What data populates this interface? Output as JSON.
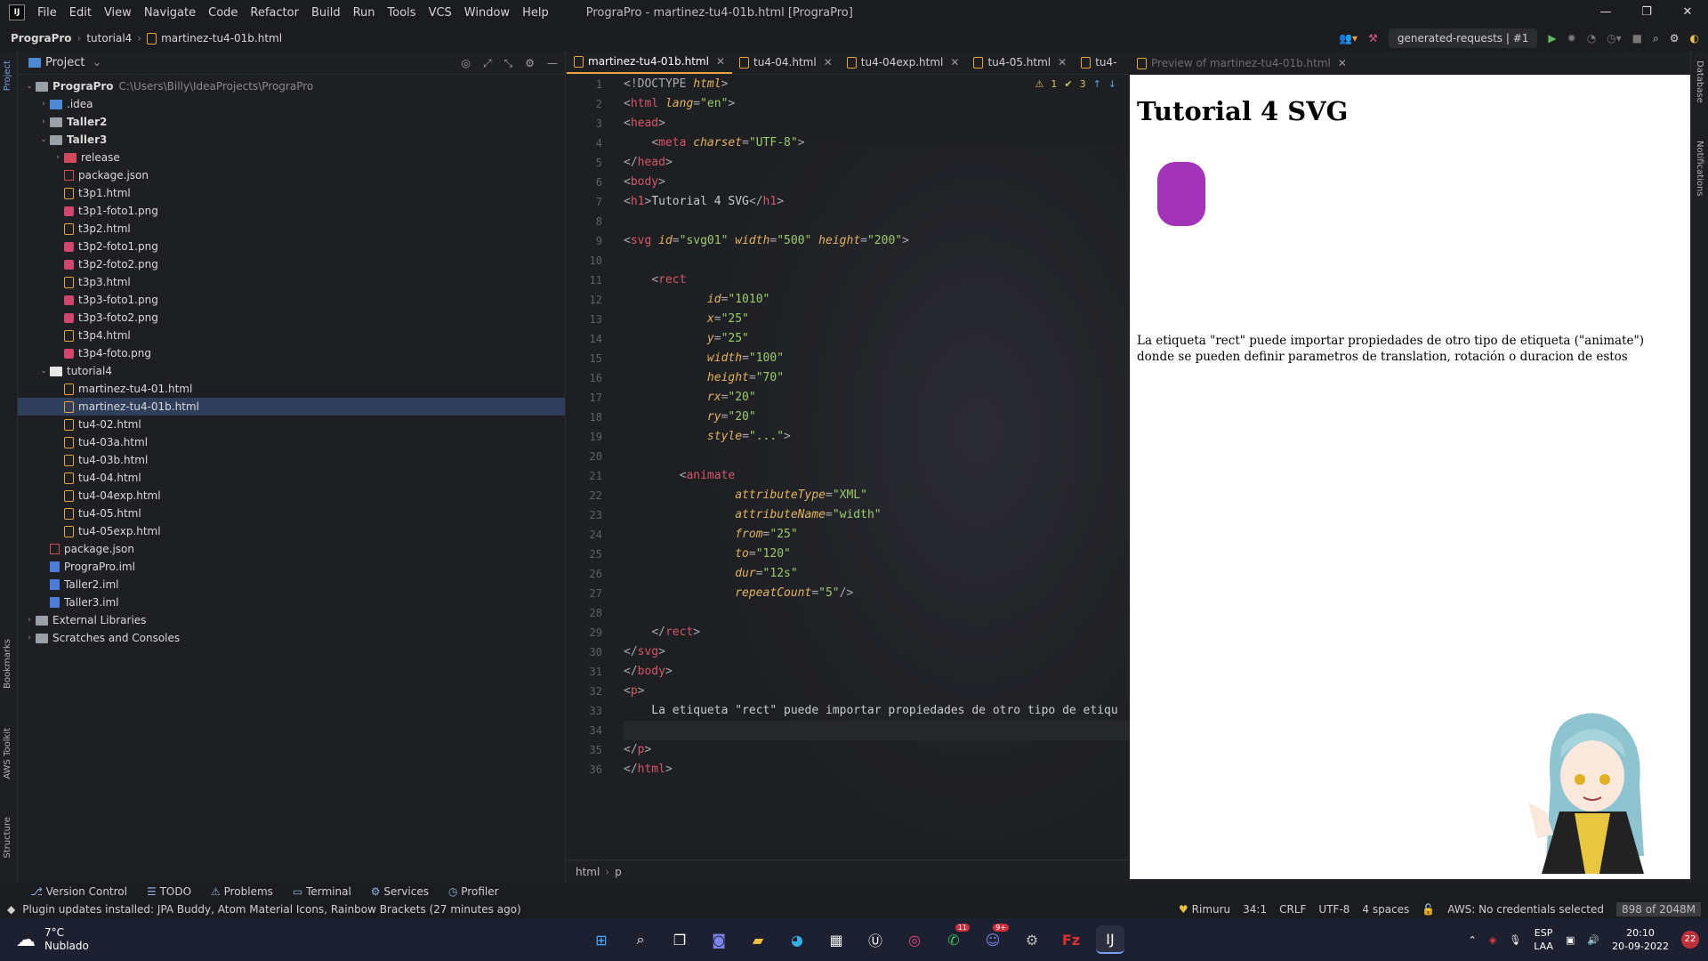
{
  "titlebar": {
    "menu": [
      "File",
      "Edit",
      "View",
      "Navigate",
      "Code",
      "Refactor",
      "Build",
      "Run",
      "Tools",
      "VCS",
      "Window",
      "Help"
    ],
    "title": "PrograPro - martinez-tu4-01b.html [PrograPro]",
    "controls": [
      "—",
      "❐",
      "✕"
    ]
  },
  "navbar": {
    "crumbs": [
      "PrograPro",
      "tutorial4",
      "martinez-tu4-01b.html"
    ],
    "run_config": "generated-requests | #1"
  },
  "project": {
    "title": "Project",
    "root": {
      "name": "PrograPro",
      "path": "C:\\Users\\Billy\\IdeaProjects\\PrograPro"
    },
    "items": [
      {
        "label": ".idea",
        "icon": "folder-blue",
        "depth": 1,
        "arrow": "›"
      },
      {
        "label": "Taller2",
        "icon": "folder",
        "depth": 1,
        "arrow": "›",
        "bold": true
      },
      {
        "label": "Taller3",
        "icon": "folder",
        "depth": 1,
        "arrow": "⌄",
        "bold": true
      },
      {
        "label": "release",
        "icon": "folder-red",
        "depth": 2,
        "arrow": "›"
      },
      {
        "label": "package.json",
        "icon": "json",
        "depth": 2
      },
      {
        "label": "t3p1.html",
        "icon": "html",
        "depth": 2
      },
      {
        "label": "t3p1-foto1.png",
        "icon": "png",
        "depth": 2
      },
      {
        "label": "t3p2.html",
        "icon": "html",
        "depth": 2
      },
      {
        "label": "t3p2-foto1.png",
        "icon": "png",
        "depth": 2
      },
      {
        "label": "t3p2-foto2.png",
        "icon": "png",
        "depth": 2
      },
      {
        "label": "t3p3.html",
        "icon": "html",
        "depth": 2
      },
      {
        "label": "t3p3-foto1.png",
        "icon": "png",
        "depth": 2
      },
      {
        "label": "t3p3-foto2.png",
        "icon": "png",
        "depth": 2
      },
      {
        "label": "t3p4.html",
        "icon": "html",
        "depth": 2
      },
      {
        "label": "t3p4-foto.png",
        "icon": "png",
        "depth": 2
      },
      {
        "label": "tutorial4",
        "icon": "folder-white",
        "depth": 1,
        "arrow": "⌄"
      },
      {
        "label": "martinez-tu4-01.html",
        "icon": "html",
        "depth": 2
      },
      {
        "label": "martinez-tu4-01b.html",
        "icon": "html",
        "depth": 2,
        "selected": true
      },
      {
        "label": "tu4-02.html",
        "icon": "html",
        "depth": 2
      },
      {
        "label": "tu4-03a.html",
        "icon": "html",
        "depth": 2
      },
      {
        "label": "tu4-03b.html",
        "icon": "html",
        "depth": 2
      },
      {
        "label": "tu4-04.html",
        "icon": "html",
        "depth": 2
      },
      {
        "label": "tu4-04exp.html",
        "icon": "html",
        "depth": 2
      },
      {
        "label": "tu4-05.html",
        "icon": "html",
        "depth": 2
      },
      {
        "label": "tu4-05exp.html",
        "icon": "html",
        "depth": 2
      },
      {
        "label": "package.json",
        "icon": "json",
        "depth": 1
      },
      {
        "label": "PrograPro.iml",
        "icon": "iml",
        "depth": 1
      },
      {
        "label": "Taller2.iml",
        "icon": "iml",
        "depth": 1
      },
      {
        "label": "Taller3.iml",
        "icon": "iml",
        "depth": 1
      },
      {
        "label": "External Libraries",
        "icon": "folder",
        "depth": 0,
        "arrow": "›"
      },
      {
        "label": "Scratches and Consoles",
        "icon": "folder",
        "depth": 0,
        "arrow": "›"
      }
    ]
  },
  "left_strip": [
    "Project",
    "Bookmarks",
    "AWS Toolkit",
    "Structure"
  ],
  "right_strip": [
    "Database",
    "Notifications"
  ],
  "tabs": [
    {
      "label": "martinez-tu4-01b.html",
      "active": true
    },
    {
      "label": "tu4-04.html"
    },
    {
      "label": "tu4-04exp.html"
    },
    {
      "label": "tu4-05.html"
    },
    {
      "label": "tu4-"
    }
  ],
  "inspections": {
    "warnings": "1",
    "checks": "3"
  },
  "code_lines": [
    [
      [
        "pu",
        "<!DOCTYPE "
      ],
      [
        "at",
        "html"
      ],
      [
        "pu",
        ">"
      ]
    ],
    [
      [
        "pu",
        "<"
      ],
      [
        "tg",
        "html"
      ],
      [
        "at",
        " lang"
      ],
      [
        "pu",
        "="
      ],
      [
        "vl",
        "\"en\""
      ],
      [
        "pu",
        ">"
      ]
    ],
    [
      [
        "pu",
        "<"
      ],
      [
        "tg",
        "head"
      ],
      [
        "pu",
        ">"
      ]
    ],
    [
      [
        "tx",
        "    "
      ],
      [
        "pu",
        "<"
      ],
      [
        "tg",
        "meta"
      ],
      [
        "at",
        " charset"
      ],
      [
        "pu",
        "="
      ],
      [
        "vl",
        "\"UTF-8\""
      ],
      [
        "pu",
        ">"
      ]
    ],
    [
      [
        "pu",
        "</"
      ],
      [
        "tg",
        "head"
      ],
      [
        "pu",
        ">"
      ]
    ],
    [
      [
        "pu",
        "<"
      ],
      [
        "tg",
        "body"
      ],
      [
        "pu",
        ">"
      ]
    ],
    [
      [
        "pu",
        "<"
      ],
      [
        "tg",
        "h1"
      ],
      [
        "pu",
        ">"
      ],
      [
        "tx",
        "Tutorial 4 SVG"
      ],
      [
        "pu",
        "</"
      ],
      [
        "tg",
        "h1"
      ],
      [
        "pu",
        ">"
      ]
    ],
    [
      [
        "tx",
        ""
      ]
    ],
    [
      [
        "pu",
        "<"
      ],
      [
        "tg",
        "svg"
      ],
      [
        "at",
        " id"
      ],
      [
        "pu",
        "="
      ],
      [
        "vl",
        "\"svg01\""
      ],
      [
        "at",
        " width"
      ],
      [
        "pu",
        "="
      ],
      [
        "vl",
        "\"500\""
      ],
      [
        "at",
        " height"
      ],
      [
        "pu",
        "="
      ],
      [
        "vl",
        "\"200\""
      ],
      [
        "pu",
        ">"
      ]
    ],
    [
      [
        "tx",
        ""
      ]
    ],
    [
      [
        "tx",
        "    "
      ],
      [
        "pu",
        "<"
      ],
      [
        "tg",
        "rect"
      ]
    ],
    [
      [
        "tx",
        "            "
      ],
      [
        "at",
        "id"
      ],
      [
        "pu",
        "="
      ],
      [
        "vl",
        "\"1010\""
      ]
    ],
    [
      [
        "tx",
        "            "
      ],
      [
        "at",
        "x"
      ],
      [
        "pu",
        "="
      ],
      [
        "vl",
        "\"25\""
      ]
    ],
    [
      [
        "tx",
        "            "
      ],
      [
        "at",
        "y"
      ],
      [
        "pu",
        "="
      ],
      [
        "vl",
        "\"25\""
      ]
    ],
    [
      [
        "tx",
        "            "
      ],
      [
        "at",
        "width"
      ],
      [
        "pu",
        "="
      ],
      [
        "vl",
        "\"100\""
      ]
    ],
    [
      [
        "tx",
        "            "
      ],
      [
        "at",
        "height"
      ],
      [
        "pu",
        "="
      ],
      [
        "vl",
        "\"70\""
      ]
    ],
    [
      [
        "tx",
        "            "
      ],
      [
        "at",
        "rx"
      ],
      [
        "pu",
        "="
      ],
      [
        "vl",
        "\"20\""
      ]
    ],
    [
      [
        "tx",
        "            "
      ],
      [
        "at",
        "ry"
      ],
      [
        "pu",
        "="
      ],
      [
        "vl",
        "\"20\""
      ]
    ],
    [
      [
        "tx",
        "            "
      ],
      [
        "at",
        "style"
      ],
      [
        "pu",
        "="
      ],
      [
        "vl",
        "\"...\""
      ],
      [
        "pu",
        ">"
      ]
    ],
    [
      [
        "tx",
        ""
      ]
    ],
    [
      [
        "tx",
        "        "
      ],
      [
        "pu",
        "<"
      ],
      [
        "tg",
        "animate"
      ]
    ],
    [
      [
        "tx",
        "                "
      ],
      [
        "at",
        "attributeType"
      ],
      [
        "pu",
        "="
      ],
      [
        "vl",
        "\"XML\""
      ]
    ],
    [
      [
        "tx",
        "                "
      ],
      [
        "at",
        "attributeName"
      ],
      [
        "pu",
        "="
      ],
      [
        "vl",
        "\"width\""
      ]
    ],
    [
      [
        "tx",
        "                "
      ],
      [
        "at",
        "from"
      ],
      [
        "pu",
        "="
      ],
      [
        "vl",
        "\"25\""
      ]
    ],
    [
      [
        "tx",
        "                "
      ],
      [
        "at",
        "to"
      ],
      [
        "pu",
        "="
      ],
      [
        "vl",
        "\"120\""
      ]
    ],
    [
      [
        "tx",
        "                "
      ],
      [
        "at",
        "dur"
      ],
      [
        "pu",
        "="
      ],
      [
        "vl",
        "\"12s\""
      ]
    ],
    [
      [
        "tx",
        "                "
      ],
      [
        "at",
        "repeatCount"
      ],
      [
        "pu",
        "="
      ],
      [
        "vl",
        "\"5\""
      ],
      [
        "pu",
        "/>"
      ]
    ],
    [
      [
        "tx",
        ""
      ]
    ],
    [
      [
        "tx",
        "    "
      ],
      [
        "pu",
        "</"
      ],
      [
        "tg",
        "rect"
      ],
      [
        "pu",
        ">"
      ]
    ],
    [
      [
        "pu",
        "</"
      ],
      [
        "tg",
        "svg"
      ],
      [
        "pu",
        ">"
      ]
    ],
    [
      [
        "pu",
        "</"
      ],
      [
        "tg",
        "body"
      ],
      [
        "pu",
        ">"
      ]
    ],
    [
      [
        "pu",
        "<"
      ],
      [
        "tg",
        "p"
      ],
      [
        "pu",
        ">"
      ]
    ],
    [
      [
        "tx",
        "    La etiqueta \"rect\" puede importar propiedades de otro tipo de etiqu"
      ]
    ],
    [
      [
        "tx",
        ""
      ]
    ],
    [
      [
        "pu",
        "</"
      ],
      [
        "tg",
        "p"
      ],
      [
        "pu",
        ">"
      ]
    ],
    [
      [
        "pu",
        "</"
      ],
      [
        "tg",
        "html"
      ],
      [
        "pu",
        ">"
      ]
    ]
  ],
  "editor_breadcrumb": [
    "html",
    "p"
  ],
  "preview": {
    "tab": "Preview of martinez-tu4-01b.html",
    "heading": "Tutorial 4 SVG",
    "rect_color": "#a233b8",
    "paragraph": "La etiqueta \"rect\" puede importar propiedades de otro tipo de etiqueta (\"animate\") donde se pueden definir parametros de translation, rotación o duracion de estos"
  },
  "tool_windows": [
    "Version Control",
    "TODO",
    "Problems",
    "Terminal",
    "Services",
    "Profiler"
  ],
  "statusbar": {
    "message": "Plugin updates installed: JPA Buddy, Atom Material Icons, Rainbow Brackets (27 minutes ago)",
    "theme": "Rimuru",
    "position": "34:1",
    "line_sep": "CRLF",
    "encoding": "UTF-8",
    "indent": "4 spaces",
    "aws": "AWS: No credentials selected",
    "memory": "898 of 2048M"
  },
  "taskbar": {
    "weather_temp": "7°C",
    "weather_desc": "Nublado",
    "lang1": "ESP",
    "lang2": "LAA",
    "time": "20:10",
    "date": "20-09-2022",
    "notifications": "22",
    "whatsapp_badge": "11",
    "discord_badge": "9+"
  }
}
